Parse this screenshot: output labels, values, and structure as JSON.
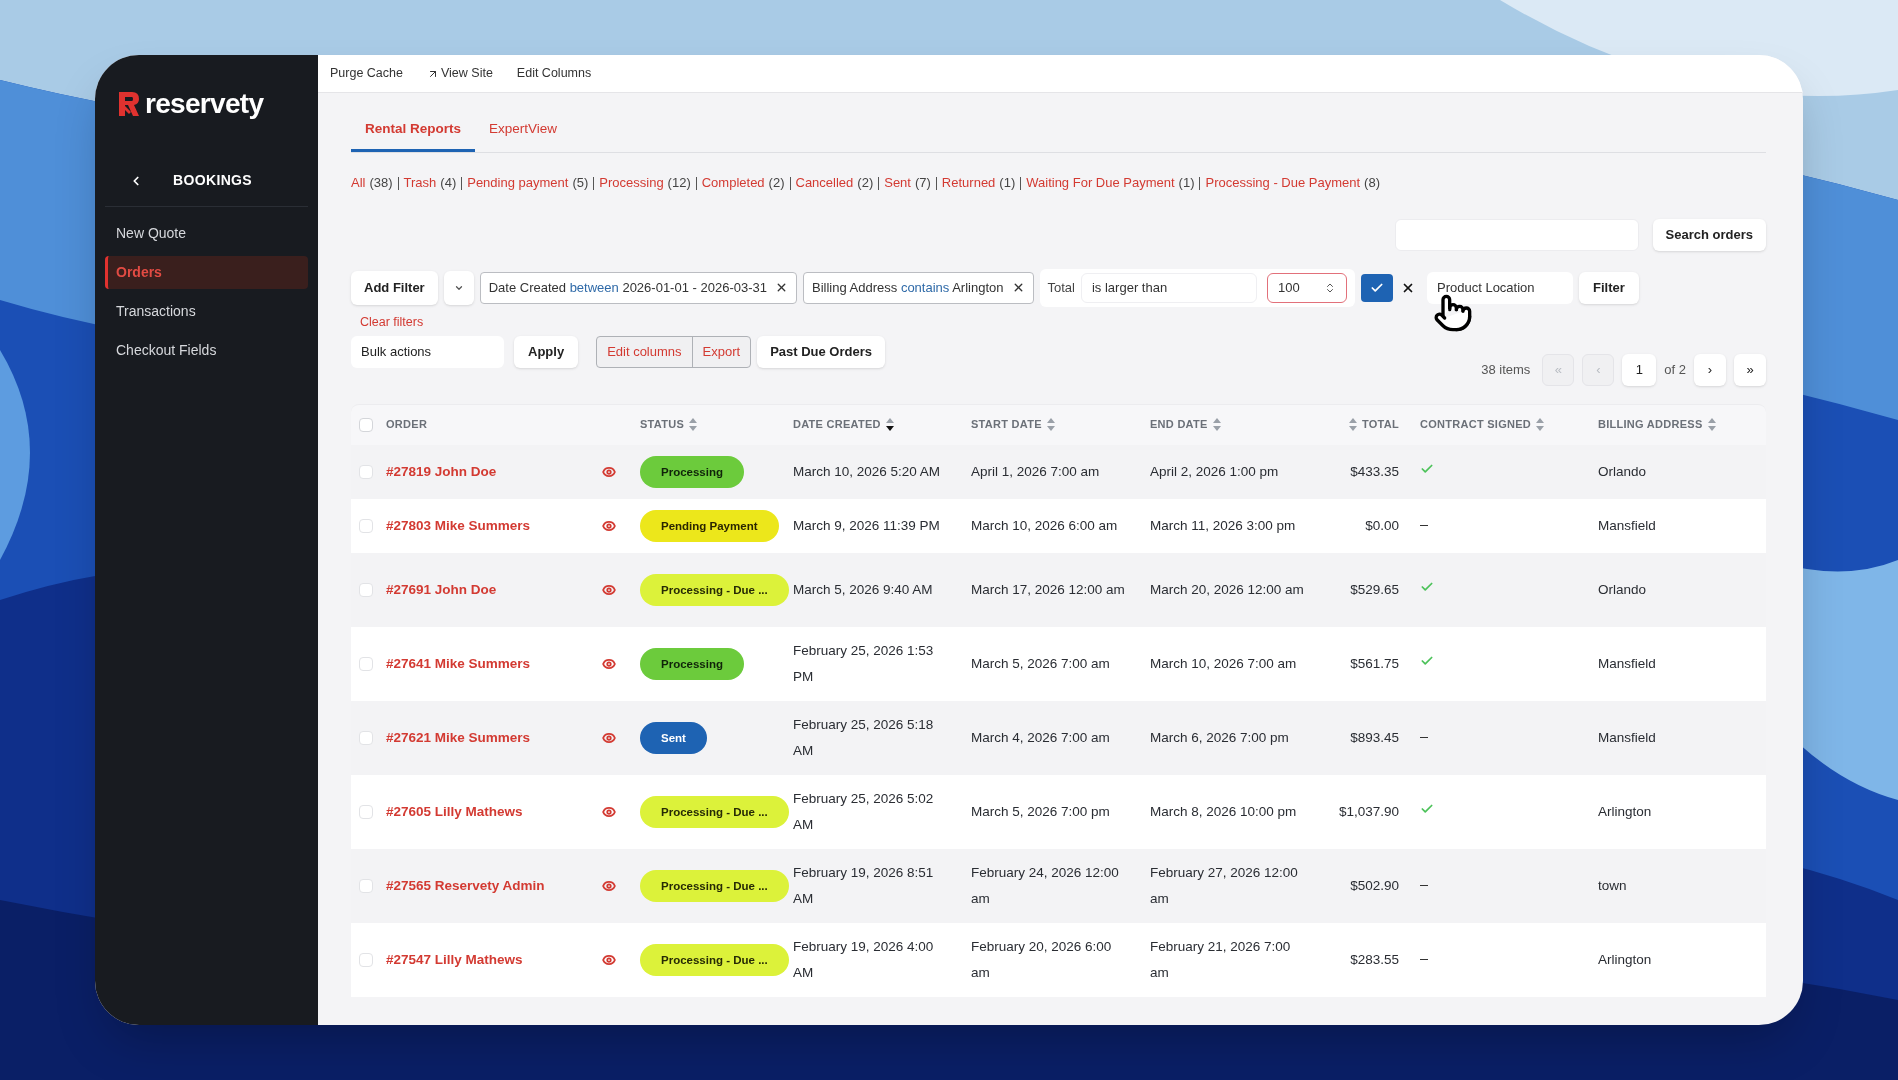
{
  "sidebar": {
    "brand": "reservety",
    "section": "BOOKINGS",
    "items": [
      {
        "label": "New Quote",
        "selected": false
      },
      {
        "label": "Orders",
        "selected": true
      },
      {
        "label": "Transactions",
        "selected": false
      },
      {
        "label": "Checkout Fields",
        "selected": false
      }
    ]
  },
  "top_bar": {
    "links": [
      {
        "label": "Purge Cache",
        "kind": "plain"
      },
      {
        "label": "View Site",
        "kind": "external"
      },
      {
        "label": "Edit Columns",
        "kind": "plain"
      }
    ]
  },
  "tabs": [
    {
      "label": "Rental Reports",
      "selected": true
    },
    {
      "label": "ExpertView",
      "selected": false
    }
  ],
  "status_filters": [
    {
      "label": "All",
      "count": "(38)"
    },
    {
      "label": "Trash",
      "count": "(4)"
    },
    {
      "label": "Pending payment",
      "count": "(5)"
    },
    {
      "label": "Processing",
      "count": "(12)"
    },
    {
      "label": "Completed",
      "count": "(2)"
    },
    {
      "label": "Cancelled",
      "count": "(2)"
    },
    {
      "label": "Sent",
      "count": "(7)"
    },
    {
      "label": "Returned",
      "count": "(1)"
    },
    {
      "label": "Waiting For Due Payment",
      "count": "(1)"
    },
    {
      "label": "Processing - Due Payment",
      "count": "(8)"
    }
  ],
  "search": {
    "button": "Search orders"
  },
  "filters": {
    "add_filter": "Add Filter",
    "chips": [
      {
        "field": "Date Created",
        "operator": "between",
        "value": "2026-01-01 - 2026-03-31"
      },
      {
        "field": "Billing Address",
        "operator": "contains",
        "value": "Arlington"
      }
    ],
    "total": {
      "label": "Total",
      "operator": "is larger than",
      "value": "100"
    },
    "product_location": "Product Location",
    "filter_button": "Filter",
    "clear": "Clear filters"
  },
  "bulk": {
    "select": "Bulk actions",
    "apply": "Apply",
    "edit_columns": "Edit columns",
    "export": "Export",
    "past_due": "Past Due Orders"
  },
  "pagination": {
    "items": "38 items",
    "first": {
      "label": "«",
      "disabled": true
    },
    "prev": {
      "label": "‹",
      "disabled": true
    },
    "page": "1",
    "of": "of 2",
    "next": {
      "label": "›",
      "disabled": false
    },
    "last": {
      "label": "»",
      "disabled": false
    }
  },
  "table": {
    "select_all_checked": false,
    "columns": [
      {
        "label": "ORDER",
        "kind": "plain"
      },
      {
        "label": "STATUS",
        "kind": "sortable"
      },
      {
        "label": "DATE CREATED",
        "kind": "sorted_desc"
      },
      {
        "label": "START DATE",
        "kind": "sortable"
      },
      {
        "label": "END DATE",
        "kind": "sortable"
      },
      {
        "label": "TOTAL",
        "kind": "sortable"
      },
      {
        "label": "CONTRACT SIGNED",
        "kind": "sortable"
      },
      {
        "label": "BILLING ADDRESS",
        "kind": "sortable"
      }
    ],
    "rows": [
      {
        "checked": false,
        "order": "#27819 John Doe",
        "status": {
          "label": "Processing",
          "kind": "processing"
        },
        "date_created": "March 10, 2026 5:20 AM",
        "start": "April 1, 2026 7:00 am",
        "end": "April 2, 2026 1:00 pm",
        "total": "$433.35",
        "contract_signed": true,
        "billing": "Orlando"
      },
      {
        "checked": false,
        "order": "#27803 Mike Summers",
        "status": {
          "label": "Pending Payment",
          "kind": "pending"
        },
        "date_created": "March 9, 2026 11:39 PM",
        "start": "March 10, 2026 6:00 am",
        "end": "March 11, 2026 3:00 pm",
        "total": "$0.00",
        "contract_signed": false,
        "billing": "Mansfield"
      },
      {
        "checked": false,
        "order": "#27691 John Doe",
        "status": {
          "label": "Processing - Due ...",
          "kind": "due"
        },
        "date_created": "March 5, 2026 9:40 AM",
        "start": "March 17, 2026 12:00 am",
        "end": "March 20, 2026 12:00 am",
        "total": "$529.65",
        "contract_signed": true,
        "billing": "Orlando"
      },
      {
        "checked": false,
        "order": "#27641 Mike Summers",
        "status": {
          "label": "Processing",
          "kind": "processing"
        },
        "date_created": "February 25, 2026 1:53 PM",
        "start": "March 5, 2026 7:00 am",
        "end": "March 10, 2026 7:00 am",
        "total": "$561.75",
        "contract_signed": true,
        "billing": "Mansfield"
      },
      {
        "checked": false,
        "order": "#27621 Mike Summers",
        "status": {
          "label": "Sent",
          "kind": "sent"
        },
        "date_created": "February 25, 2026 5:18 AM",
        "start": "March 4, 2026 7:00 am",
        "end": "March 6, 2026 7:00 pm",
        "total": "$893.45",
        "contract_signed": false,
        "billing": "Mansfield"
      },
      {
        "checked": false,
        "order": "#27605 Lilly Mathews",
        "status": {
          "label": "Processing - Due ...",
          "kind": "due"
        },
        "date_created": "February 25, 2026 5:02 AM",
        "start": "March 5, 2026 7:00 pm",
        "end": "March 8, 2026 10:00 pm",
        "total": "$1,037.90",
        "contract_signed": true,
        "billing": "Arlington"
      },
      {
        "checked": false,
        "order": "#27565 Reservety Admin",
        "status": {
          "label": "Processing - Due ...",
          "kind": "due"
        },
        "date_created": "February 19, 2026 8:51 AM",
        "start": "February 24, 2026 12:00 am",
        "end": "February 27, 2026 12:00 am",
        "total": "$502.90",
        "contract_signed": false,
        "billing": "town"
      },
      {
        "checked": false,
        "order": "#27547 Lilly Mathews",
        "status": {
          "label": "Processing - Due ...",
          "kind": "due"
        },
        "date_created": "February 19, 2026 4:00 AM",
        "start": "February 20, 2026 6:00 am",
        "end": "February 21, 2026 7:00 am",
        "total": "$283.55",
        "contract_signed": false,
        "billing": "Arlington"
      }
    ]
  }
}
